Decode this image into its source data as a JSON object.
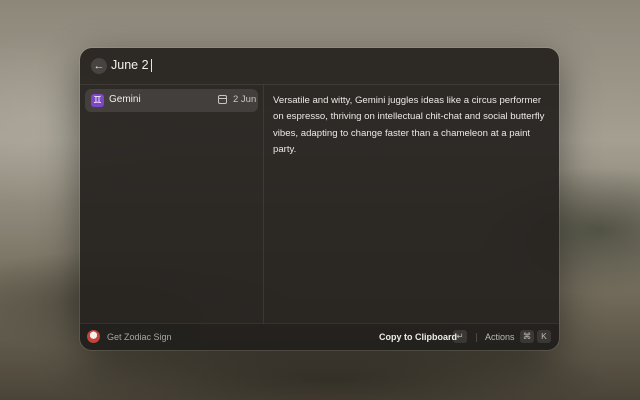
{
  "search": {
    "query": "June 2"
  },
  "list": {
    "items": [
      {
        "icon": "gemini-icon",
        "glyph": "♊",
        "label": "Gemini",
        "date": "2 Jun"
      }
    ]
  },
  "detail": {
    "text": "Versatile and witty, Gemini juggles ideas like a circus performer on espresso, thriving on intellectual chit-chat and social butterfly vibes, adapting to change faster than a chameleon at a paint party."
  },
  "footer": {
    "app_name": "Get Zodiac Sign",
    "primary_action": "Copy to Clipboard",
    "primary_shortcut": "↵",
    "actions_label": "Actions",
    "actions_shortcut_mod": "⌘",
    "actions_shortcut_key": "K"
  },
  "colors": {
    "accent_gemini": "#7d46c9",
    "window_bg": "#262320"
  }
}
